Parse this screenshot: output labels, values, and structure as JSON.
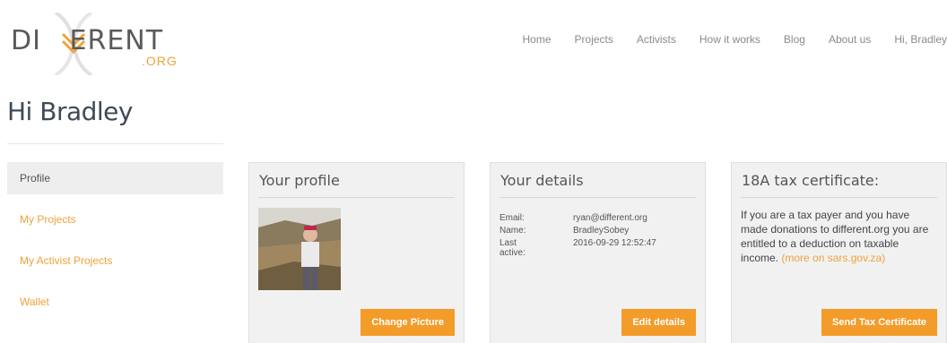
{
  "logo": {
    "wordmark": "DI   ERENT",
    "suffix": ".ORG",
    "alt_text": "DIFFERENT.ORG"
  },
  "nav": {
    "items": [
      "Home",
      "Projects",
      "Activists",
      "How it works",
      "Blog",
      "About us",
      "Hi, Bradley"
    ]
  },
  "page": {
    "title": "Hi Bradley"
  },
  "sidebar": {
    "items": [
      {
        "label": "Profile",
        "active": true
      },
      {
        "label": "My Projects",
        "active": false
      },
      {
        "label": "My Activist Projects",
        "active": false
      },
      {
        "label": "Wallet",
        "active": false
      }
    ]
  },
  "profile_card": {
    "title": "Your profile",
    "button": "Change Picture"
  },
  "details_card": {
    "title": "Your details",
    "email_label": "Email:",
    "email_value": "ryan@different.org",
    "name_label": "Name:",
    "name_value": "BradleySobey",
    "last_active_label_1": "Last",
    "last_active_label_2": "active:",
    "last_active_value": "2016-09-29 12:52:47",
    "button": "Edit details"
  },
  "tax_card": {
    "title": "18A tax certificate:",
    "text": "If you are a tax payer and you have made donations to different.org you are entitled to a deduction on taxable income.",
    "link": "(more on sars.gov.za)",
    "button": "Send Tax Certificate"
  },
  "colors": {
    "accent": "#f39c2a",
    "link": "#f0a23a",
    "card_bg": "#f1f1f1",
    "active_nav_bg": "#eeeeee"
  },
  "icons": {
    "logo_mark": "dna-helix-icon"
  }
}
